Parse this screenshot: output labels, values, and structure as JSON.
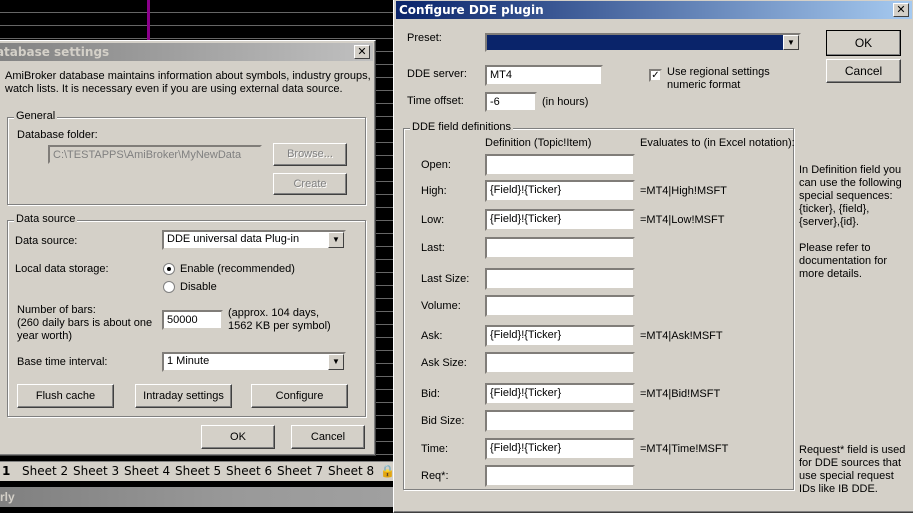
{
  "database_settings": {
    "title": "Database settings",
    "description_line1": "AmiBroker database maintains information about symbols, industry groups,",
    "description_line2": "watch lists. It is necessary even if you are using external data source.",
    "general": {
      "label": "General",
      "folder_label": "Database folder:",
      "folder_value": "C:\\TESTAPPS\\AmiBroker\\MyNewData",
      "browse": "Browse...",
      "create": "Create"
    },
    "data_source": {
      "label": "Data source",
      "source_label": "Data source:",
      "source_value": "DDE universal data Plug-in",
      "storage_label": "Local data storage:",
      "enable": "Enable (recommended)",
      "disable": "Disable",
      "bars_label1": "Number of bars:",
      "bars_label2": "(260 daily bars is about one",
      "bars_label3": "year worth)",
      "bars_value": "50000",
      "bars_note1": "(approx. 104 days,",
      "bars_note2": "1562 KB per symbol)",
      "interval_label": "Base time interval:",
      "interval_value": "1 Minute",
      "flush": "Flush cache",
      "intraday": "Intraday settings",
      "configure": "Configure"
    },
    "ok": "OK",
    "cancel": "Cancel"
  },
  "sheets": [
    "1",
    "Sheet 2",
    "Sheet 3",
    "Sheet 4",
    "Sheet 5",
    "Sheet 6",
    "Sheet 7",
    "Sheet 8"
  ],
  "bottom_bar": "rly",
  "dde": {
    "title": "Configure DDE plugin",
    "preset_label": "Preset:",
    "ok": "OK",
    "cancel": "Cancel",
    "server_label": "DDE server:",
    "server_value": "MT4",
    "regional_line1": "Use regional settings",
    "regional_line2": "numeric format",
    "regional_checked": true,
    "offset_label": "Time offset:",
    "offset_value": "-6",
    "offset_unit": "(in hours)",
    "group_label": "DDE field definitions",
    "col_def": "Definition (Topic!Item)",
    "col_eval": "Evaluates to (in Excel notation):",
    "rows": [
      {
        "label": "Open:",
        "def": "",
        "eval": ""
      },
      {
        "label": "High:",
        "def": "{Field}!{Ticker}",
        "eval": "=MT4|High!MSFT"
      },
      {
        "label": "Low:",
        "def": "{Field}!{Ticker}",
        "eval": "=MT4|Low!MSFT"
      },
      {
        "label": "Last:",
        "def": "",
        "eval": ""
      },
      {
        "label": "Last Size:",
        "def": "",
        "eval": ""
      },
      {
        "label": "Volume:",
        "def": "",
        "eval": ""
      },
      {
        "label": "Ask:",
        "def": "{Field}!{Ticker}",
        "eval": "=MT4|Ask!MSFT"
      },
      {
        "label": "Ask Size:",
        "def": "",
        "eval": ""
      },
      {
        "label": "Bid:",
        "def": "{Field}!{Ticker}",
        "eval": "=MT4|Bid!MSFT"
      },
      {
        "label": "Bid Size:",
        "def": "",
        "eval": ""
      },
      {
        "label": "Time:",
        "def": "{Field}!{Ticker}",
        "eval": "=MT4|Time!MSFT"
      },
      {
        "label": "Req*:",
        "def": "",
        "eval": ""
      }
    ],
    "help1": "In Definition field you can use the following special sequences: {ticker}, {field}, {server},{id}.",
    "help2": "Please refer to documentation for more details.",
    "help3": "Request* field is used for DDE sources that use special request IDs like IB DDE."
  }
}
